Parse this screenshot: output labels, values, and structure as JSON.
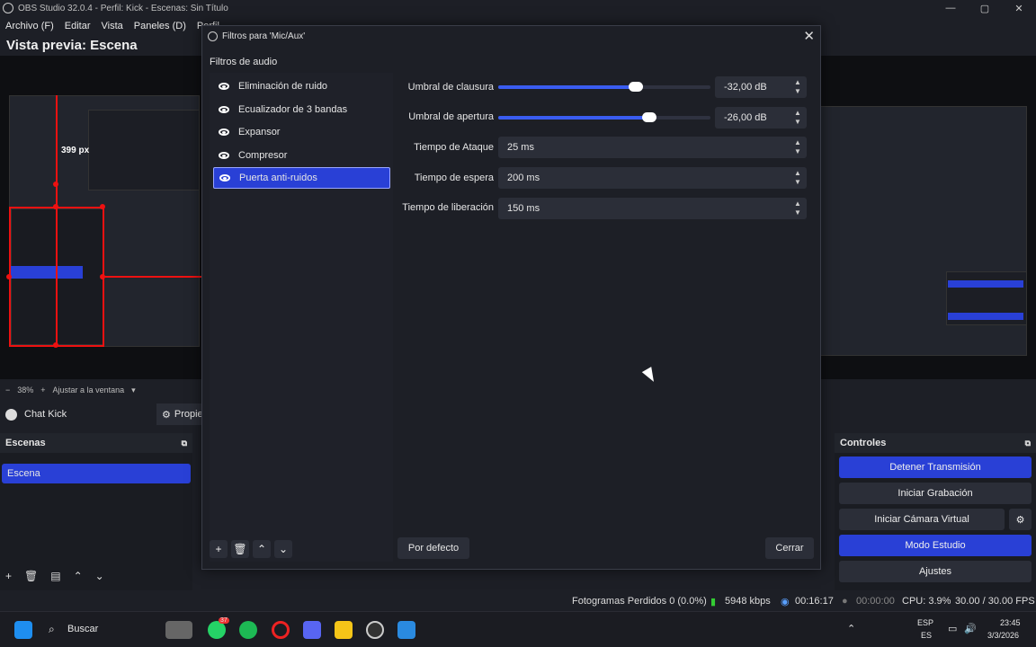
{
  "window": {
    "title": "OBS Studio 32.0.4 - Perfil: Kick - Escenas: Sin Título"
  },
  "menu": [
    "Archivo (F)",
    "Editar",
    "Vista",
    "Paneles (D)",
    "Perfil"
  ],
  "preview": {
    "title": "Vista previa: Escena",
    "zoom": "38%",
    "fit_label": "Ajustar a la ventana",
    "size_label": "399 px"
  },
  "docks": {
    "chat_label": "Chat Kick",
    "props_label": "Propie"
  },
  "scenes": {
    "header": "Escenas",
    "items": [
      "Escena"
    ]
  },
  "controls": {
    "header": "Controles",
    "buttons": [
      "Detener Transmisión",
      "Iniciar Grabación",
      "Iniciar Cámara Virtual",
      "Modo Estudio",
      "Ajustes"
    ]
  },
  "dialog": {
    "title": "Filtros para 'Mic/Aux'",
    "list_label": "Filtros de audio",
    "filters": [
      "Eliminación de ruido",
      "Ecualizador de 3 bandas",
      "Expansor",
      "Compresor",
      "Puerta anti-ruidos"
    ],
    "selected_filter": "Puerta anti-ruidos",
    "props": {
      "close_threshold": {
        "label": "Umbral de clausura",
        "value": "-32,00 dB",
        "level": 0.65
      },
      "open_threshold": {
        "label": "Umbral de apertura",
        "value": "-26,00 dB",
        "level": 0.71
      },
      "attack": {
        "label": "Tiempo de Ataque",
        "value": "25 ms"
      },
      "hold": {
        "label": "Tiempo de espera",
        "value": "200 ms"
      },
      "release": {
        "label": "Tiempo de liberación",
        "value": "150 ms"
      }
    },
    "default_button": "Por defecto",
    "close_button": "Cerrar"
  },
  "status": {
    "frames_dropped": "Fotogramas Perdidos 0 (0.0%)",
    "bitrate": "5948 kbps",
    "stream_time": "00:16:17",
    "rec_time": "00:00:00",
    "cpu": "CPU: 3.9%",
    "fps": "30.00 / 30.00 FPS"
  },
  "taskbar": {
    "search": "Buscar",
    "lang_top": "ESP",
    "lang_bottom": "ES",
    "time": "23:45",
    "date": "3/3/2026",
    "badge": "37"
  },
  "colors": {
    "accent": "#2940d6",
    "bg": "#1d1f26",
    "red": "#e11111"
  }
}
